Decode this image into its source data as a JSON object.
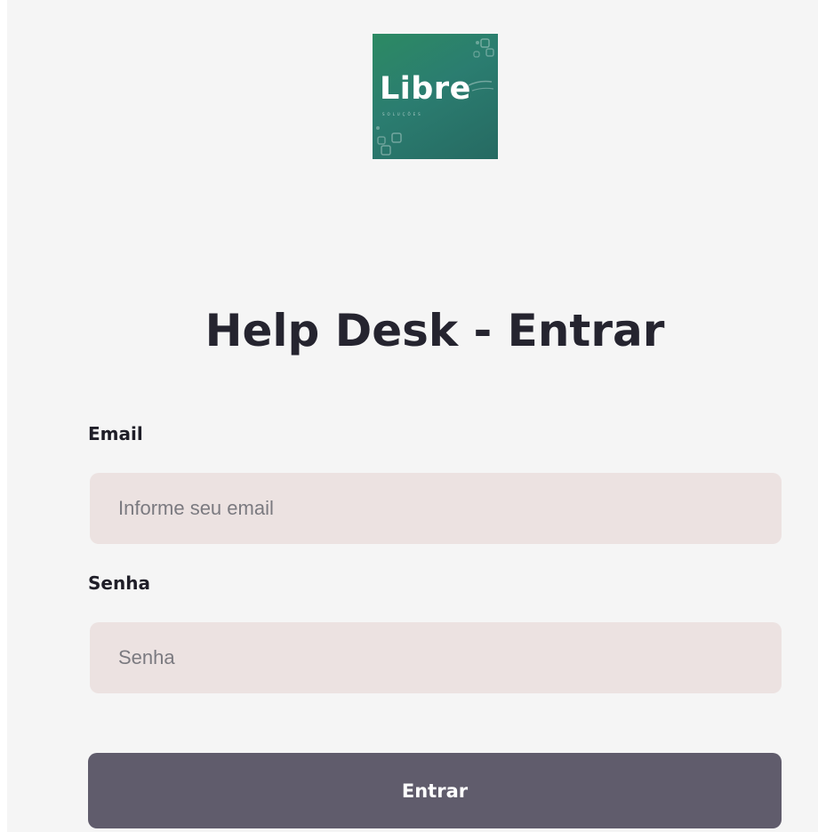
{
  "logo": {
    "text": "Libre",
    "subtext": "SOLUÇÕES",
    "colors": {
      "background": "#2b7d6a",
      "text": "#ffffff"
    }
  },
  "title": "Help Desk - Entrar",
  "form": {
    "email": {
      "label": "Email",
      "value": "",
      "placeholder": "Informe seu email"
    },
    "password": {
      "label": "Senha",
      "value": "",
      "placeholder": "Senha"
    },
    "submit_label": "Entrar"
  },
  "colors": {
    "page_background": "#f5f5f5",
    "title": "#25242f",
    "input_background": "#ece2e1",
    "button_background": "#605c6c",
    "button_text": "#ffffff"
  }
}
